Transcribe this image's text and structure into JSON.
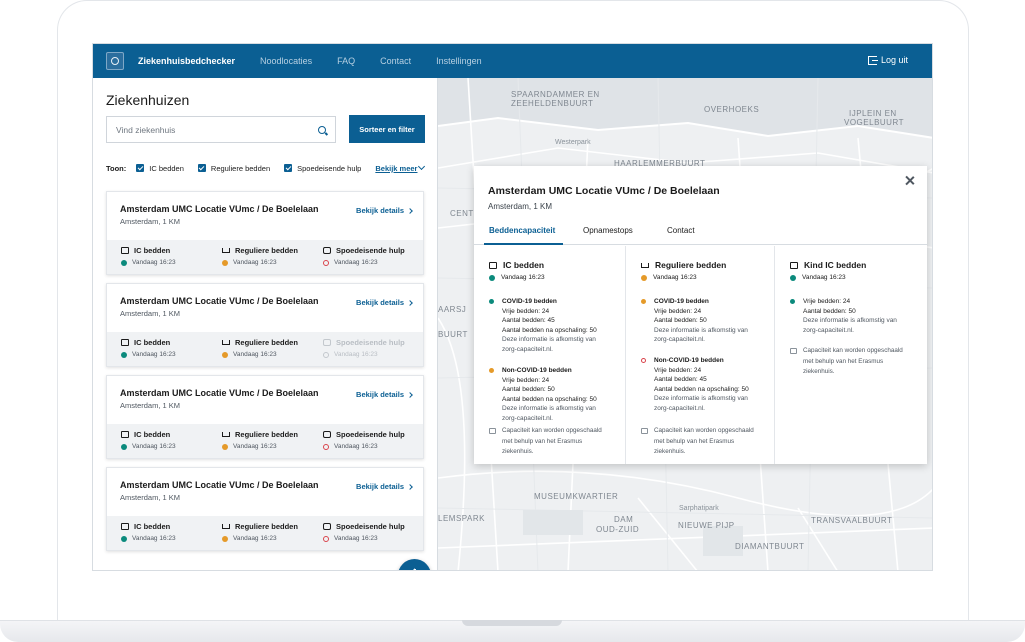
{
  "nav": {
    "brand": "Ziekenhuisbedchecker",
    "links": [
      "Noodlocaties",
      "FAQ",
      "Contact",
      "Instellingen"
    ],
    "logout": "Log uit"
  },
  "sidebar": {
    "title": "Ziekenhuizen",
    "search_placeholder": "Vind ziekenhuis",
    "sort_button": "Sorteer en filter",
    "toon_label": "Toon:",
    "filters": [
      "IC bedden",
      "Reguliere bedden",
      "Spoedeisende hulp"
    ],
    "more": "Bekijk meer"
  },
  "cards": [
    {
      "title": "Amsterdam UMC Locatie VUmc / De Boelelaan",
      "location": "Amsterdam, 1 KM",
      "details": "Bekijk details",
      "stats": [
        {
          "name": "IC bedden",
          "time": "Vandaag 16:23",
          "status": "green"
        },
        {
          "name": "Reguliere bedden",
          "time": "Vandaag 16:23",
          "status": "orange"
        },
        {
          "name": "Spoedeisende hulp",
          "time": "Vandaag 16:23",
          "status": "red-ring"
        }
      ]
    },
    {
      "title": "Amsterdam UMC Locatie VUmc / De Boelelaan",
      "location": "Amsterdam, 1 KM",
      "details": "Bekijk details",
      "stats": [
        {
          "name": "IC bedden",
          "time": "Vandaag 16:23",
          "status": "green"
        },
        {
          "name": "Reguliere bedden",
          "time": "Vandaag 16:23",
          "status": "orange"
        },
        {
          "name": "Spoedeisende hulp",
          "time": "Vandaag 16:23",
          "status": "disabled"
        }
      ]
    },
    {
      "title": "Amsterdam UMC Locatie VUmc / De Boelelaan",
      "location": "Amsterdam, 1 KM",
      "details": "Bekijk details",
      "stats": [
        {
          "name": "IC bedden",
          "time": "Vandaag 16:23",
          "status": "green"
        },
        {
          "name": "Reguliere bedden",
          "time": "Vandaag 16:23",
          "status": "orange"
        },
        {
          "name": "Spoedeisende hulp",
          "time": "Vandaag 16:23",
          "status": "red-ring"
        }
      ]
    },
    {
      "title": "Amsterdam UMC Locatie VUmc / De Boelelaan",
      "location": "Amsterdam, 1 KM",
      "details": "Bekijk details",
      "stats": [
        {
          "name": "IC bedden",
          "time": "Vandaag 16:23",
          "status": "green"
        },
        {
          "name": "Reguliere bedden",
          "time": "Vandaag 16:23",
          "status": "orange"
        },
        {
          "name": "Spoedeisende hulp",
          "time": "Vandaag 16:23",
          "status": "red-ring"
        }
      ]
    }
  ],
  "map_labels": [
    "SPAARNDAMMER EN",
    "ZEEHELDENBUURT",
    "OVERHOEKS",
    "IJPLEIN EN",
    "VOGELBUURT",
    "Westerpark",
    "HAARLEMMERBUURT",
    "CENTI",
    "AARSJ",
    "BUURT",
    "MUSEUMKWARTIER",
    "Sarphatipark",
    "LEMSPARK",
    "DAM",
    "OUD-ZUID",
    "NIEUWE PIJP",
    "TRANSVAALBUURT",
    "DIAMANTBUURT"
  ],
  "panel": {
    "title": "Amsterdam UMC Locatie VUmc / De Boelelaan",
    "location": "Amsterdam, 1 KM",
    "tabs": [
      "Beddencapaciteit",
      "Opnamestops",
      "Contact"
    ],
    "columns": [
      {
        "heading": "IC bedden",
        "time": "Vandaag 16:23",
        "blocks": [
          {
            "title": "COVID-19 bedden",
            "lines": [
              "Vrije bedden: 24",
              "Aantal bedden: 45",
              "Aantal bedden na opschaling: 50"
            ],
            "source": [
              "Deze informatie is afkomstig van",
              "zorg-capaciteit.nl."
            ]
          },
          {
            "title": "Non-COVID-19 bedden",
            "lines": [
              "Vrije bedden: 24",
              "Aantal bedden: 50",
              "Aantal bedden na opschaling: 50"
            ],
            "source": [
              "Deze informatie is afkomstig van",
              "zorg-capaciteit.nl."
            ]
          }
        ],
        "note": [
          "Capaciteit kan worden opgeschaald",
          "met behulp van het Erasmus",
          "ziekenhuis."
        ]
      },
      {
        "heading": "Reguliere bedden",
        "time": "Vandaag 16:23",
        "blocks": [
          {
            "title": "COVID-19 bedden",
            "lines": [
              "Vrije bedden: 24",
              "Aantal bedden: 50"
            ],
            "source": [
              "Deze informatie is afkomstig van",
              "zorg-capaciteit.nl."
            ]
          },
          {
            "title": "Non-COVID-19 bedden",
            "lines": [
              "Vrije bedden: 24",
              "Aantal bedden: 45",
              "Aantal bedden na opschaling: 50"
            ],
            "source": [
              "Deze informatie is afkomstig van",
              "zorg-capaciteit.nl."
            ]
          }
        ],
        "note": [
          "Capaciteit kan worden opgeschaald",
          "met behulp van het Erasmus",
          "ziekenhuis."
        ]
      },
      {
        "heading": "Kind IC bedden",
        "time": "Vandaag 16:23",
        "blocks": [
          {
            "title": "",
            "lines": [
              "Vrije bedden: 24",
              "Aantal bedden: 50"
            ],
            "source": [
              "Deze informatie is afkomstig van",
              "zorg-capaciteit.nl."
            ]
          }
        ],
        "note": [
          "Capaciteit kan worden opgeschaald",
          "met behulp van het Erasmus",
          "ziekenhuis."
        ]
      }
    ]
  },
  "colors": {
    "primary": "#0b5f93",
    "green": "#0b8a7c",
    "orange": "#e59a29",
    "red": "#d9434b"
  }
}
